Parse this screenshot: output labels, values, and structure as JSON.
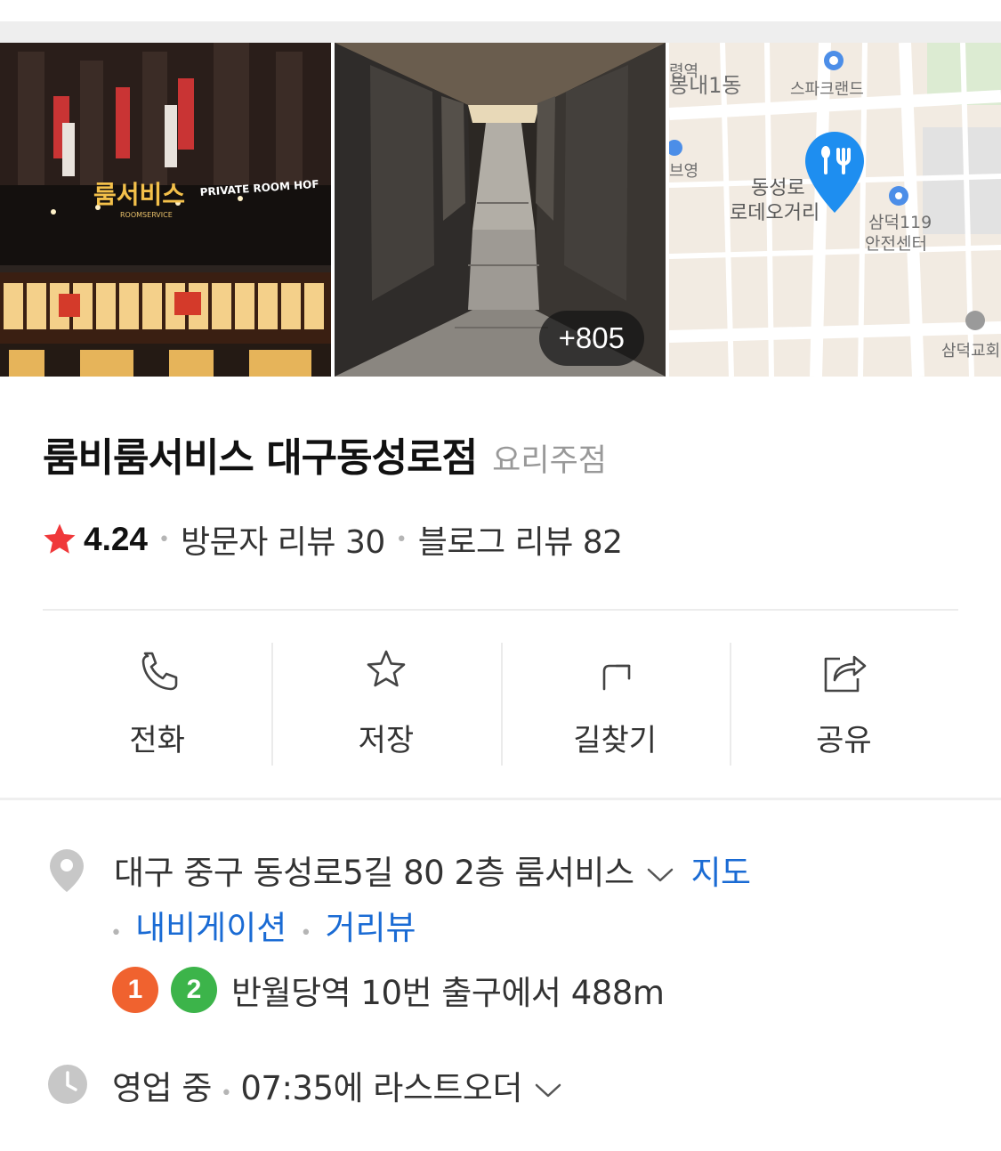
{
  "photos": {
    "more_count": "+805",
    "storefront_sign": "룸서비스",
    "storefront_sub": "ROOMSERVICE",
    "storefront_hof": "PRIVATE ROOM HOF",
    "map_labels": {
      "area1": "봉내1동",
      "area2": "스파크랜드",
      "area3": "동성로",
      "area4": "로데오거리",
      "area5": "삼덕119",
      "area6": "안전센터",
      "area7": "삼덕교회",
      "area8": "브영",
      "area9": "령역"
    }
  },
  "place": {
    "name": "룸비룸서비스 대구동성로점",
    "category": "요리주점",
    "rating": "4.24",
    "visitor_reviews": "방문자 리뷰 30",
    "blog_reviews": "블로그 리뷰 82"
  },
  "actions": [
    {
      "label": "전화",
      "icon": "phone-icon"
    },
    {
      "label": "저장",
      "icon": "star-outline-icon"
    },
    {
      "label": "길찾기",
      "icon": "directions-icon"
    },
    {
      "label": "공유",
      "icon": "share-icon"
    }
  ],
  "info": {
    "address": "대구 중구 동성로5길 80 2층 룸서비스",
    "map_link": "지도",
    "navigation_link": "내비게이션",
    "street_view_link": "거리뷰",
    "subway_line1": "1",
    "subway_line2": "2",
    "subway_text": "반월당역 10번 출구에서 488m",
    "hours_status": "영업 중",
    "last_order": "07:35에 라스트오더"
  },
  "colors": {
    "star": "#f0383a",
    "link": "#1a6bd4",
    "line1": "#f0622f",
    "line2": "#3cb44a",
    "map_pin": "#1e8ef0"
  }
}
